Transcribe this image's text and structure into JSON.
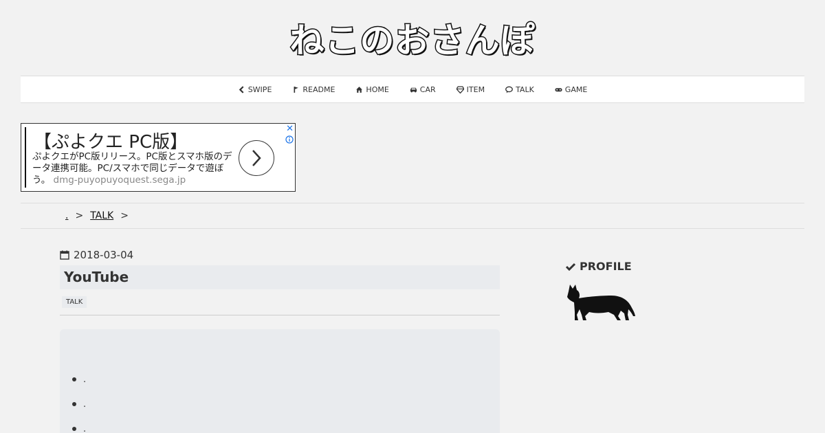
{
  "header": {
    "logo_text": "ねこのおさんぽ"
  },
  "nav": {
    "items": [
      {
        "label": "SWIPE",
        "icon": "chevron-left-icon"
      },
      {
        "label": "README",
        "icon": "flag-icon"
      },
      {
        "label": "HOME",
        "icon": "home-icon"
      },
      {
        "label": "CAR",
        "icon": "car-icon"
      },
      {
        "label": "ITEM",
        "icon": "diamond-icon"
      },
      {
        "label": "TALK",
        "icon": "comment-icon"
      },
      {
        "label": "GAME",
        "icon": "gamepad-icon"
      }
    ]
  },
  "ad": {
    "title": "【ぷよクエ PC版】",
    "description": "ぷよクエがPC版リリース。PC版とスマホ版のデータ連携可能。PC/スマホで同じデータで遊ぼう。",
    "domain": "dmg-puyopuyoquest.sega.jp",
    "close_label": "✕"
  },
  "breadcrumb": {
    "items": [
      {
        "label": "."
      },
      {
        "label": "TALK"
      }
    ],
    "separator": ">"
  },
  "post": {
    "date": "2018-03-04",
    "title": "YouTube",
    "tag": "TALK",
    "list_items": [
      ".",
      ".",
      "."
    ]
  },
  "sidebar": {
    "profile_label": "PROFILE"
  },
  "colors": {
    "background": "#f2f2f2",
    "title_bg": "#e9ebee",
    "ad_info": "#1a73e8"
  }
}
